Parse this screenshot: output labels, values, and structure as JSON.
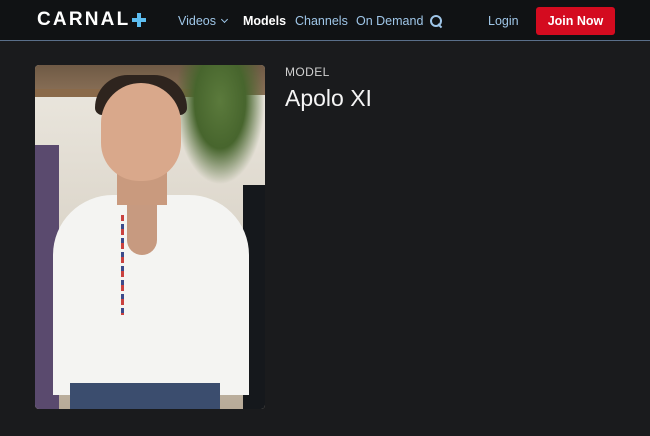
{
  "header": {
    "logo_text": "CARNAL",
    "logo_plus_color": "#5dbdf0",
    "nav": {
      "videos": "Videos",
      "models": "Models",
      "channels": "Channels",
      "on_demand": "On Demand"
    },
    "login": "Login",
    "join": "Join Now",
    "join_color": "#d40b1f"
  },
  "model": {
    "label": "MODEL",
    "name": "Apolo XI"
  }
}
